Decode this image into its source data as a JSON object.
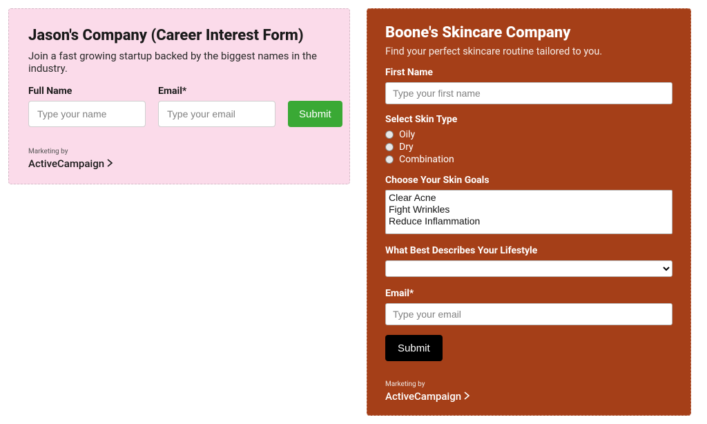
{
  "left": {
    "title": "Jason's Company (Career Interest Form)",
    "subtitle": "Join a fast growing startup backed by the biggest names in the industry.",
    "full_name_label": "Full Name",
    "full_name_placeholder": "Type your name",
    "email_label": "Email*",
    "email_placeholder": "Type your email",
    "submit_label": "Submit",
    "marketing_by": "Marketing by",
    "brand": "ActiveCampaign"
  },
  "right": {
    "title": "Boone's Skincare Company",
    "subtitle": "Find your perfect skincare routine tailored to you.",
    "first_name_label": "First Name",
    "first_name_placeholder": "Type your first name",
    "skin_type_label": "Select Skin Type",
    "skin_type_options": {
      "0": "Oily",
      "1": "Dry",
      "2": "Combination"
    },
    "skin_goals_label": "Choose Your Skin Goals",
    "skin_goals_options": {
      "0": "Clear Acne",
      "1": "Fight Wrinkles",
      "2": "Reduce Inflammation"
    },
    "lifestyle_label": "What Best Describes Your Lifestyle",
    "email_label": "Email*",
    "email_placeholder": "Type your email",
    "submit_label": "Submit",
    "marketing_by": "Marketing by",
    "brand": "ActiveCampaign"
  }
}
